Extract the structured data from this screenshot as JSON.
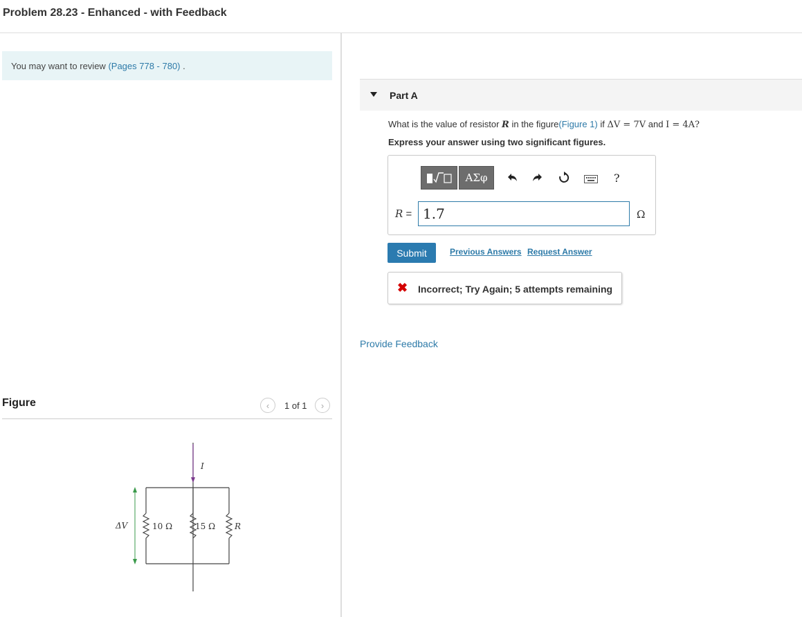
{
  "page": {
    "title": "Problem 28.23 - Enhanced - with Feedback"
  },
  "review": {
    "prefix": "You may want to review",
    "link": "(Pages 778 - 780)",
    "suffix": "."
  },
  "figure": {
    "title": "Figure",
    "pager": "1 of 1",
    "prev_icon": "chevron-left-icon",
    "next_icon": "chevron-right-icon",
    "current_label": "I",
    "voltage_label": "ΔV",
    "resistor_labels": [
      "10 Ω",
      "15 Ω",
      "R"
    ]
  },
  "part": {
    "label": "Part A",
    "question_pre": "What is the value of resistor",
    "question_var": "R",
    "question_mid": "in the figure",
    "question_link": "(Figure 1)",
    "question_if": "if",
    "question_dv": "ΔV = 7V",
    "question_and": "and",
    "question_i": "I = 4A?",
    "instruction": "Express your answer using two significant figures."
  },
  "toolbar": {
    "template_icon": "template-icon",
    "greek_label": "ΑΣφ",
    "undo_icon": "undo-icon",
    "redo_icon": "redo-icon",
    "reset_icon": "reset-icon",
    "keyboard_icon": "keyboard-icon",
    "help_label": "?"
  },
  "answer": {
    "label": "R =",
    "value": "1.7",
    "unit": "Ω"
  },
  "actions": {
    "submit": "Submit",
    "previous": "Previous Answers",
    "request": "Request Answer"
  },
  "feedback": {
    "icon": "✖",
    "message": "Incorrect; Try Again; 5 attempts remaining"
  },
  "provide_feedback": "Provide Feedback",
  "colors": {
    "accent": "#2b7bb0",
    "error": "#d40000",
    "review_bg": "#e8f4f6"
  }
}
